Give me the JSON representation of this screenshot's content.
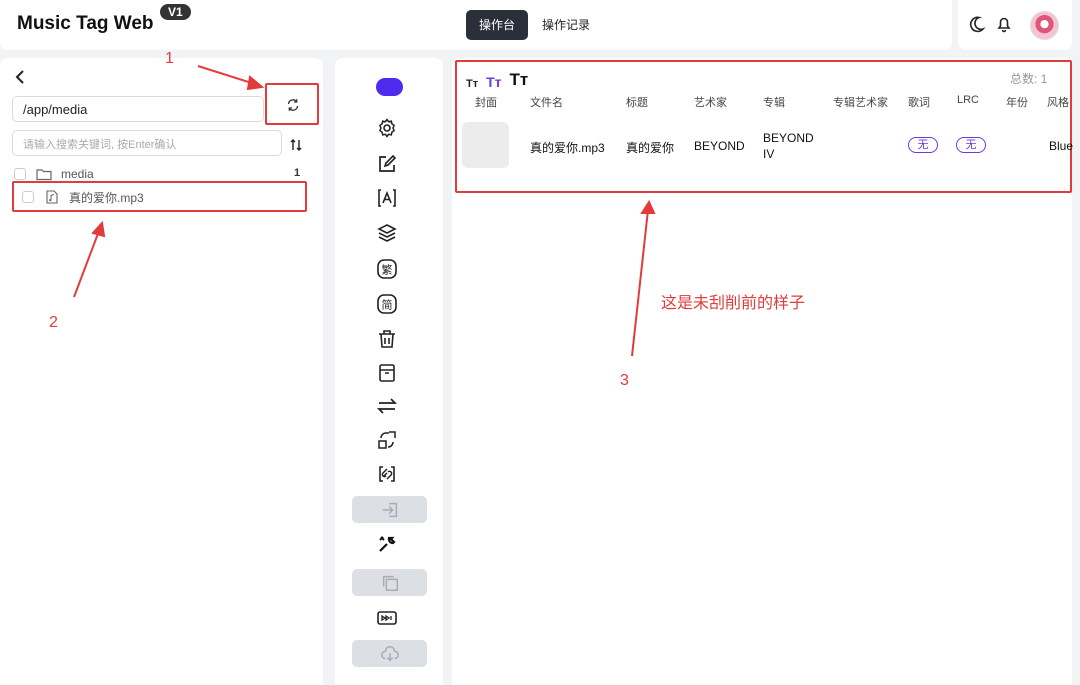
{
  "header": {
    "app_title": "Music Tag Web",
    "version": "V1",
    "tabs": [
      {
        "label": "操作台",
        "active": true
      },
      {
        "label": "操作记录",
        "active": false
      }
    ],
    "icons": [
      "moon-icon",
      "bell-icon",
      "avatar"
    ]
  },
  "left_panel": {
    "path_value": "/app/media",
    "search_placeholder": "请输入搜索关键词, 按Enter确认",
    "tree": [
      {
        "type": "folder",
        "name": "media",
        "count": "1"
      },
      {
        "type": "file",
        "name": "真的爱你.mp3"
      }
    ]
  },
  "toolbar": {
    "tools": [
      "settings-icon",
      "edit-icon",
      "auto-tag-icon",
      "layers-icon",
      "traditional-icon",
      "simplified-icon",
      "trash-icon",
      "archive-icon",
      "swap-icon",
      "convert-icon",
      "unlink-icon",
      "import-icon",
      "wrench-icon",
      "copy-icon",
      "media-icon",
      "cloud-download-icon"
    ],
    "traditional_char": "繁",
    "simplified_char": "简"
  },
  "table": {
    "total_label": "总数: 1",
    "font_size_glyph": "Tт",
    "columns": [
      "封面",
      "文件名",
      "标题",
      "艺术家",
      "专辑",
      "专辑艺术家",
      "歌词",
      "LRC",
      "年份",
      "风格"
    ],
    "rows": [
      {
        "filename": "真的爱你.mp3",
        "title": "真的爱你",
        "artist": "BEYOND",
        "album": "BEYOND IV",
        "lyrics": "无",
        "lrc": "无",
        "genre": "Blue"
      }
    ]
  },
  "annotations": {
    "n1": "1",
    "n2": "2",
    "n3": "3",
    "note": "这是未刮削前的样子"
  },
  "colors": {
    "accent": "#4f2bf0",
    "badge": "#6a3bd8",
    "annotation": "#e23b3b"
  }
}
